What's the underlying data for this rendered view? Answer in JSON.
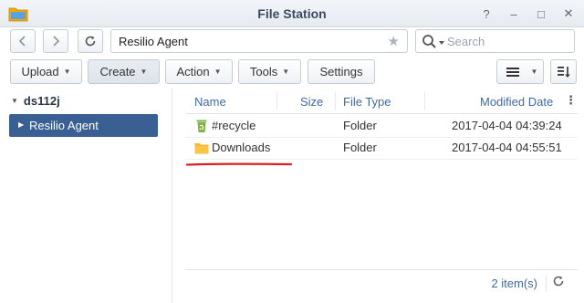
{
  "window": {
    "title": "File Station",
    "controls": [
      "?",
      "–",
      "□",
      "✕"
    ]
  },
  "nav": {
    "back_icon": "chevron-left-icon",
    "forward_icon": "chevron-right-icon",
    "refresh_icon": "refresh-icon",
    "path": "Resilio Agent",
    "favorite_icon": "star-icon",
    "search_placeholder": "Search"
  },
  "toolbar": {
    "upload_label": "Upload",
    "create_label": "Create",
    "action_label": "Action",
    "tools_label": "Tools",
    "settings_label": "Settings",
    "view_icon": "list-view-icon",
    "sort_icon": "sort-icon"
  },
  "tree": {
    "root_label": "ds112j",
    "items": [
      {
        "label": "Resilio Agent",
        "selected": true
      }
    ]
  },
  "filelist": {
    "columns": [
      "Name",
      "Size",
      "File Type",
      "Modified Date"
    ],
    "rows": [
      {
        "icon": "recycle-bin-icon",
        "name": "#recycle",
        "size": "",
        "type": "Folder",
        "modified": "2017-04-04 04:39:24"
      },
      {
        "icon": "folder-icon",
        "name": "Downloads",
        "size": "",
        "type": "Folder",
        "modified": "2017-04-04 04:55:51"
      }
    ]
  },
  "status": {
    "count_text": "2 item(s)"
  },
  "colors": {
    "accent": "#3a5f93",
    "header_text": "#3f6aa0",
    "annotation": "#d92020",
    "folder": "#f5b82e",
    "recycle": "#7cb342"
  }
}
